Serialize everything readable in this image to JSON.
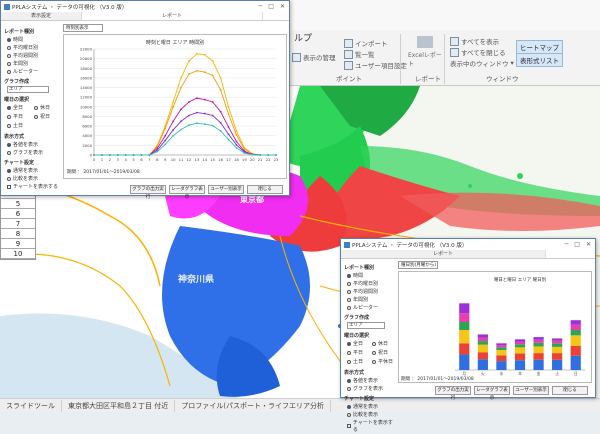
{
  "app": {
    "help_label": "ルプ",
    "ribbon": {
      "import_label": "インポート",
      "list_label": "覧一覧",
      "user_settings_label": "ユーザー項目設定",
      "display_manage_label": "表示の管理",
      "excel_report_label": "Excelレポート",
      "show_all_label": "すべてを表示",
      "hide_all_label": "すべてを閉じる",
      "display_window_label": "表示中のウィンドウ",
      "heatmap_label": "ヒートマップ",
      "table_list_label": "表形式リスト",
      "group_point": "ポイント",
      "group_report": "レポート",
      "group_window": "ウィンドウ"
    },
    "map_labels": {
      "kanagawa": "神奈川県",
      "tokyo": "東京都"
    },
    "row_numbers": [
      "4",
      "5",
      "6",
      "7",
      "8",
      "9",
      "10"
    ],
    "statusbar": {
      "tool": "スライドツール",
      "address": "東京都大田区平和島２丁目 付近",
      "profile": "プロファイル(パスポート・ライフエリア分析"
    }
  },
  "dialog1": {
    "title": "PPLAシステム ・ データの可視化 （V3.0 版）",
    "tabs": [
      "表示設定",
      "レポート"
    ],
    "report_type_label": "レポート種別",
    "report_options": [
      "時間",
      "平均曜日別",
      "平均週間別",
      "年間別",
      "ルピーター"
    ],
    "group_label": "グラフ作成",
    "group_select": "エリア",
    "week_label": "曜日の選択",
    "week_options": [
      "全日",
      "平日",
      "土日",
      "休日",
      "祝日",
      "平休日"
    ],
    "display_label": "表示方式",
    "display_options": [
      "各値を表示",
      "グラフを表示"
    ],
    "chart_setting_label": "チャート設定",
    "chart_setting_options": [
      "通常を表示",
      "比較を表示"
    ],
    "chart_redraw": "チャートを表示する",
    "top_select": "時刻別表示",
    "chart_title": "時刻と曜日 エリア 時間別",
    "period": "期間 ： 2017/01/01～2019/03/08",
    "buttons": [
      "グラフの出力実行",
      "レーダグラフ表示",
      "ユーザー別表示",
      "閉じる"
    ]
  },
  "dialog2": {
    "title": "PPLAシステム ・ データの可視化 （V3.0 版）",
    "tab": "レポート",
    "report_type_label": "レポート種別",
    "report_options": [
      "時間",
      "平均曜日別",
      "平均週間別",
      "年間別",
      "ルピーター"
    ],
    "group_label": "グラフ作成",
    "group_select": "エリア",
    "week_label": "曜日の選択",
    "week_options": [
      "全日",
      "平日",
      "土日",
      "休日",
      "祝日",
      "平休日"
    ],
    "display_label": "表示方式",
    "display_options": [
      "各値を表示",
      "グラフを表示"
    ],
    "chart_setting_label": "チャート設定",
    "chart_setting_options": [
      "通常を表示",
      "比較を表示"
    ],
    "chart_redraw": "チャートを表示する",
    "top_select": "曜日別(月曜から)",
    "chart_title": "曜日と曜日 エリア 曜日別",
    "period": "期間 ： 2017/01/01～2019/03/08",
    "buttons": [
      "グラフの出力実行",
      "レーダグラフ表示",
      "ユーザー別表示",
      "閉じる"
    ]
  },
  "chart_data": [
    {
      "type": "line",
      "title": "時刻と曜日 エリア 時間別",
      "x": [
        "0",
        "1",
        "2",
        "3",
        "4",
        "5",
        "6",
        "7",
        "8",
        "9",
        "10",
        "11",
        "12",
        "13",
        "14",
        "15",
        "16",
        "17",
        "18",
        "19",
        "20",
        "21",
        "22",
        "23"
      ],
      "ylim": [
        0,
        22000
      ],
      "yticks": [
        0,
        2000,
        4000,
        6000,
        8000,
        10000,
        12000,
        14000,
        16000,
        18000,
        20000,
        22000
      ],
      "series": [
        {
          "color": "#f5b800",
          "values": [
            0,
            0,
            0,
            0,
            0,
            0,
            0,
            0,
            2000,
            6000,
            11000,
            16000,
            19500,
            21000,
            20800,
            19500,
            16000,
            10000,
            5000,
            1500,
            300,
            0,
            0,
            0
          ]
        },
        {
          "color": "#f39c12",
          "values": [
            0,
            0,
            0,
            0,
            0,
            0,
            0,
            0,
            1800,
            5500,
            10000,
            14000,
            16800,
            17500,
            17200,
            16500,
            13500,
            8500,
            4200,
            1200,
            200,
            0,
            0,
            0
          ]
        },
        {
          "color": "#c0169b",
          "values": [
            0,
            0,
            0,
            0,
            0,
            0,
            0,
            0,
            1400,
            4000,
            7000,
            9500,
            11000,
            11800,
            11500,
            11000,
            9000,
            5800,
            2800,
            800,
            100,
            0,
            0,
            0
          ]
        },
        {
          "color": "#7b2fd9",
          "values": [
            0,
            0,
            0,
            0,
            0,
            0,
            0,
            0,
            1000,
            3000,
            5200,
            7000,
            8200,
            8800,
            8600,
            8200,
            6700,
            4300,
            2100,
            600,
            100,
            0,
            0,
            0
          ]
        },
        {
          "color": "#2ec4b6",
          "values": [
            0,
            0,
            0,
            0,
            0,
            0,
            0,
            0,
            700,
            2200,
            4000,
            5300,
            6200,
            6600,
            6400,
            6100,
            5000,
            3200,
            1500,
            400,
            50,
            0,
            0,
            0
          ]
        }
      ]
    },
    {
      "type": "bar",
      "title": "曜日と曜日 エリア 曜日別",
      "categories": [
        "月",
        "火",
        "水",
        "木",
        "金",
        "土",
        "日"
      ],
      "ylim": [
        0,
        180
      ],
      "stacked": true,
      "series": [
        {
          "color": "#2f6fe0",
          "values": [
            35,
            24,
            20,
            22,
            23,
            23,
            32
          ]
        },
        {
          "color": "#ea4335",
          "values": [
            25,
            16,
            13,
            15,
            15,
            15,
            22
          ]
        },
        {
          "color": "#f5c518",
          "values": [
            30,
            17,
            12,
            14,
            15,
            14,
            24
          ]
        },
        {
          "color": "#2aa655",
          "values": [
            18,
            8,
            6,
            7,
            8,
            8,
            12
          ]
        },
        {
          "color": "#e83fb0",
          "values": [
            20,
            8,
            5,
            6,
            7,
            6,
            12
          ]
        },
        {
          "color": "#9b30d9",
          "values": [
            22,
            7,
            4,
            5,
            6,
            5,
            10
          ]
        }
      ]
    }
  ]
}
